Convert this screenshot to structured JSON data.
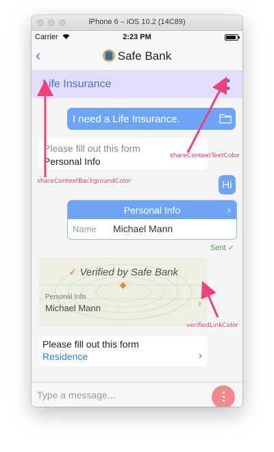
{
  "window": {
    "title": "iPhone 6 – iOS 10.2 (14C89)"
  },
  "status_bar": {
    "carrier": "Carrier",
    "wifi_icon": "wifi-icon",
    "time": "2:23 PM",
    "battery_level": 0.85
  },
  "nav_bar": {
    "back_icon": "chevron-left-icon",
    "title": "Safe Bank",
    "logo_icon": "safe-bank-logo"
  },
  "context_bar": {
    "title": "Life Insurance",
    "share_icon": "share-icon",
    "background": "#e2ddfb",
    "text_color": "#4a6fd6"
  },
  "messages": {
    "request": {
      "text": "I need a Life Insurance.",
      "icon": "folder-icon"
    },
    "form_prompt": {
      "line1": "Please fill out this form",
      "line2": "Personal Info"
    },
    "reply": {
      "text": "Hi"
    },
    "personal_card": {
      "header": "Personal Info",
      "field_label": "Name",
      "field_value": "Michael Mann"
    },
    "sent_status": "Sent",
    "verified_card": {
      "title": "Verified by Safe Bank",
      "label": "Personal Info",
      "value": "Michael Mann",
      "link_color": "#e88a1f"
    },
    "form_prompt_2": {
      "line1": "Please fill out this form",
      "line2": "Residence"
    }
  },
  "input": {
    "placeholder": "Type a message..."
  },
  "fab": {
    "icon": "more-vertical-icon",
    "color": "#f08a8e"
  },
  "annotations": {
    "share_context_background": "shareContextBackgroundColor",
    "share_context_text": "shareContextTextColor",
    "verified_link": "verifiedLinkColor"
  },
  "colors": {
    "bubble": "#6ea4f4",
    "accent": "#d42d6b"
  }
}
